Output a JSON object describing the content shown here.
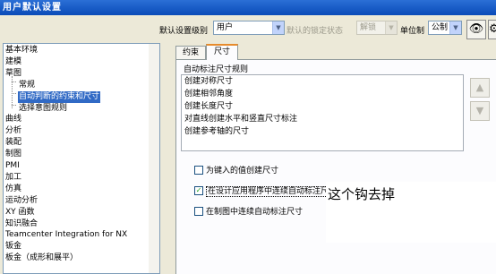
{
  "window": {
    "title": "用户默认设置"
  },
  "toolbar": {
    "level_label": "默认设置级别",
    "level_value": "用户",
    "lock_label": "默认的锁定状态",
    "lock_value": "解锁",
    "unit_label": "单位制",
    "unit_value": "公制",
    "btn1_icon": "view-icon",
    "btn2_icon": "settings-icon"
  },
  "tree": {
    "items": [
      "基本环境",
      "建模",
      "草图",
      "常规",
      "自动判断的约束和尺寸",
      "选择意图规则",
      "曲线",
      "分析",
      "装配",
      "制图",
      "PMI",
      "加工",
      "仿真",
      "运动分析",
      "XY 函数",
      "知识融合",
      "Teamcenter Integration for NX",
      "钣金",
      "板金（成形和展平）"
    ],
    "selected_index": 4
  },
  "tabs": [
    {
      "label": "约束"
    },
    {
      "label": "尺寸"
    }
  ],
  "active_tab": 1,
  "dimension": {
    "section_label": "自动标注尺寸规则",
    "rules": [
      "创建对称尺寸",
      "创建相邻角度",
      "创建长度尺寸",
      "对直线创建水平和竖直尺寸标注",
      "创建参考轴的尺寸"
    ],
    "checkboxes": [
      {
        "label": "为键入的值创建尺寸",
        "checked": false
      },
      {
        "label": "在设计应用程序中连续自动标注尺寸",
        "checked": true
      },
      {
        "label": "在制图中连续自动标注尺寸",
        "checked": false
      }
    ],
    "help_icon": "?"
  },
  "annotation": {
    "text": "这个钩去掉"
  }
}
